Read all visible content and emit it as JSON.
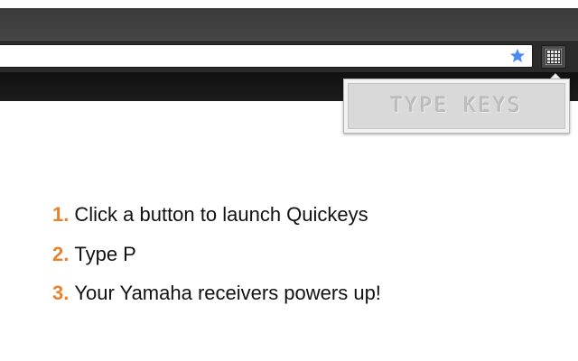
{
  "popup": {
    "display_text": "TYPE KEYS"
  },
  "toolbar": {
    "bookmark_icon": "star-icon",
    "extension_icon": "keypad-grid-icon"
  },
  "steps": [
    {
      "number": "1.",
      "text": "Click a button to launch Quickeys"
    },
    {
      "number": "2.",
      "text": "Type P"
    },
    {
      "number": "3.",
      "text": "Your Yamaha receivers powers up!"
    }
  ],
  "colors": {
    "step_number": "#e8822e",
    "bookmark_star": "#4a8af4",
    "chrome_dark": "#2b2b2b"
  }
}
